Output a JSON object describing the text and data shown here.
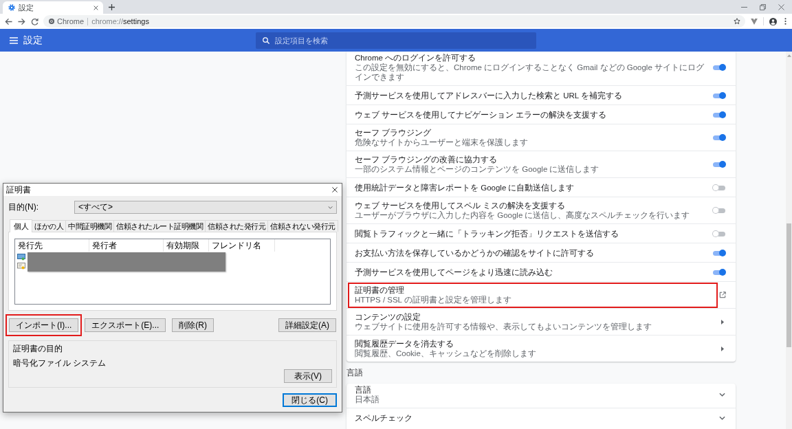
{
  "browser": {
    "tab": {
      "title": "設定",
      "selected": true
    },
    "address_bar": {
      "site_label": "Chrome",
      "url_scheme": "chrome://",
      "url_rest": "settings"
    }
  },
  "settings_header": {
    "title": "設定",
    "search": {
      "placeholder": "設定項目を検索"
    }
  },
  "privacy_card": {
    "rows": [
      {
        "kind": "toggle",
        "title": "Chrome へのログインを許可する",
        "description": "この設定を無効にすると、Chrome にログインすることなく Gmail などの Google サイトにログインできます",
        "on": true,
        "highlighted": false
      },
      {
        "kind": "toggle",
        "title": "予測サービスを使用してアドレスバーに入力した検索と URL を補完する",
        "on": true,
        "highlighted": false
      },
      {
        "kind": "toggle",
        "title": "ウェブ サービスを使用してナビゲーション エラーの解決を支援する",
        "on": true,
        "highlighted": false
      },
      {
        "kind": "toggle",
        "title": "セーフ ブラウジング",
        "description": "危険なサイトからユーザーと端末を保護します",
        "on": true,
        "highlighted": false
      },
      {
        "kind": "toggle",
        "title": "セーフ ブラウジングの改善に協力する",
        "description": "一部のシステム情報とページのコンテンツを Google に送信します",
        "on": true,
        "highlighted": false
      },
      {
        "kind": "toggle",
        "title": "使用統計データと障害レポートを Google に自動送信します",
        "on": false,
        "highlighted": false
      },
      {
        "kind": "toggle",
        "title": "ウェブ サービスを使用してスペル ミスの解決を支援する",
        "description": "ユーザーがブラウザに入力した内容を Google に送信し、高度なスペルチェックを行います",
        "on": false,
        "highlighted": false
      },
      {
        "kind": "toggle",
        "title": "閲覧トラフィックと一緒に「トラッキング拒否」リクエストを送信する",
        "on": false,
        "highlighted": false
      },
      {
        "kind": "toggle",
        "title": "お支払い方法を保存しているかどうかの確認をサイトに許可する",
        "on": true,
        "highlighted": false
      },
      {
        "kind": "toggle",
        "title": "予測サービスを使用してページをより迅速に読み込む",
        "on": true,
        "highlighted": false
      },
      {
        "kind": "external",
        "title": "証明書の管理",
        "description": "HTTPS / SSL の証明書と設定を管理します",
        "highlighted": true
      },
      {
        "kind": "link",
        "title": "コンテンツの設定",
        "description": "ウェブサイトに使用を許可する情報や、表示してもよいコンテンツを管理します",
        "highlighted": false
      },
      {
        "kind": "link",
        "title": "閲覧履歴データを消去する",
        "description": "閲覧履歴、Cookie、キャッシュなどを削除します",
        "highlighted": false
      }
    ]
  },
  "language_section": {
    "heading": "言語",
    "rows": [
      {
        "kind": "expand",
        "title": "言語",
        "description": "日本語"
      },
      {
        "kind": "expand",
        "title": "スペルチェック"
      }
    ]
  },
  "certificate_dialog": {
    "title": "証明書",
    "purpose_label": "目的(N):",
    "purpose_value": "<すべて>",
    "tabs": [
      {
        "label": "個人",
        "selected": true
      },
      {
        "label": "ほかの人",
        "selected": false
      },
      {
        "label": "中間証明機関",
        "selected": false
      },
      {
        "label": "信頼されたルート証明機関",
        "selected": false
      },
      {
        "label": "信頼された発行元",
        "selected": false
      },
      {
        "label": "信頼されない発行元",
        "selected": false
      }
    ],
    "columns": [
      "発行先",
      "発行者",
      "有効期限",
      "フレンドリ名"
    ],
    "buttons": [
      {
        "label": "インポート(I)...",
        "highlighted": true
      },
      {
        "label": "エクスポート(E)...",
        "highlighted": false
      },
      {
        "label": "削除(R)",
        "highlighted": false
      },
      {
        "label": "詳細設定(A)",
        "highlighted": false
      }
    ],
    "purpose_group": {
      "label": "証明書の目的",
      "value": "暗号化ファイル システム",
      "button": "表示(V)"
    },
    "close_button": {
      "label": "閉じる(C)",
      "focused": true
    }
  }
}
